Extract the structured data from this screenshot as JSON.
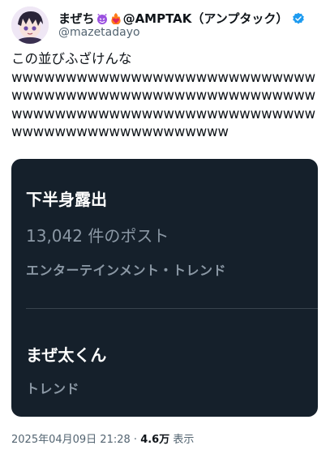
{
  "header": {
    "display_name": "まぜち",
    "display_name_suffix": "@AMPTAK（アンプタック）",
    "emojis": [
      "smiling-imp-icon",
      "heart-on-fire-icon"
    ],
    "handle": "@mazetadayo",
    "verified": true
  },
  "tweet": {
    "text_line1": "この並びふざけんな",
    "text_line2": "wwwwwwwwwwwwwwwwwwwwwwwwwwwwwwwwwwwwwwwwwwwwwwwwwwwwwwwwwwwwwwwwwwwwwwwwwwwwwwwwwwwwwwwwwwwwwwwwwwwwwwww"
  },
  "trends_card": {
    "background": "#15202b",
    "items": [
      {
        "title": "下半身露出",
        "count": "13,042 件のポスト",
        "category": "エンターテインメント・トレンド"
      },
      {
        "title": "まぜ太くん",
        "category": "トレンド"
      }
    ]
  },
  "footer": {
    "timestamp": "2025年04月09日 21:28",
    "separator": "·",
    "views_count": "4.6万",
    "views_label": "表示"
  },
  "colors": {
    "verified_blue": "#1d9bf0",
    "text_primary": "#0f1419",
    "text_secondary": "#536471"
  }
}
